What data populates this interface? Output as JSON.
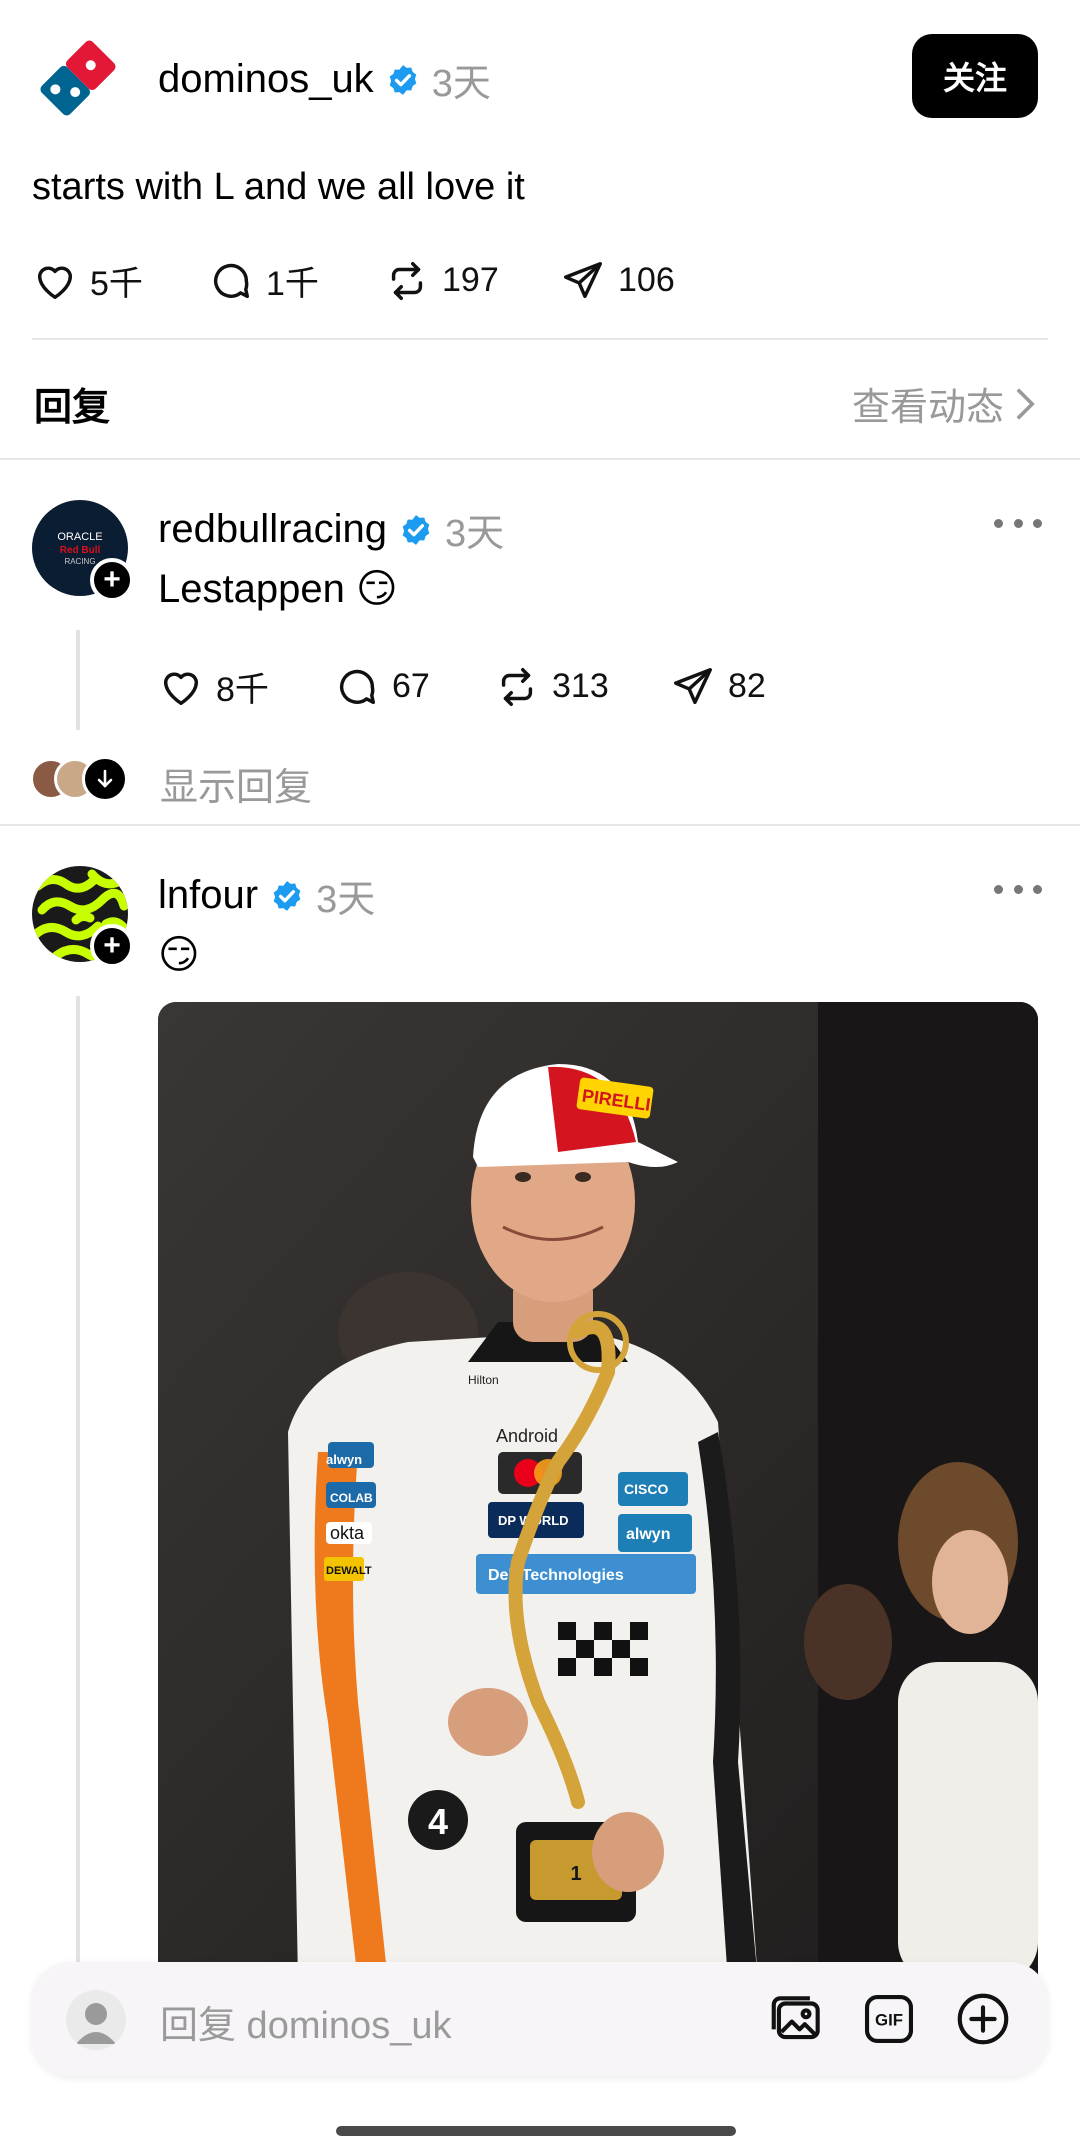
{
  "post": {
    "author": "dominos_uk",
    "time": "3天",
    "follow_label": "关注",
    "text": "starts with L and we all love it",
    "stats": {
      "likes": "5千",
      "comments": "1千",
      "reposts": "197",
      "shares": "106"
    }
  },
  "replies_header": {
    "label": "回复",
    "view_activity": "查看动态"
  },
  "replies": [
    {
      "author": "redbullracing",
      "time": "3天",
      "text": "Lestappen 😏",
      "avatar_text": [
        "ORACLE",
        "Red Bull",
        "RACING"
      ],
      "stats": {
        "likes": "8千",
        "comments": "67",
        "reposts": "313",
        "shares": "82"
      },
      "show_replies": "显示回复"
    },
    {
      "author": "lnfour",
      "time": "3天",
      "text": "😏"
    }
  ],
  "photo": {
    "cap_text": "PIRELLI",
    "suit_sponsors": [
      "Hilton",
      "Android",
      "CISCO",
      "DP WORLD",
      "Dell Technologies",
      "okta",
      "DEWALT",
      "COLAB",
      "alwyn"
    ],
    "car_number": "4"
  },
  "composer": {
    "placeholder": "回复 dominos_uk"
  },
  "colors": {
    "verified": "#1d9bf0",
    "muted": "#999999",
    "dominos_red": "#e31837",
    "dominos_blue": "#006491",
    "lnfour_green": "#c8ff00"
  }
}
